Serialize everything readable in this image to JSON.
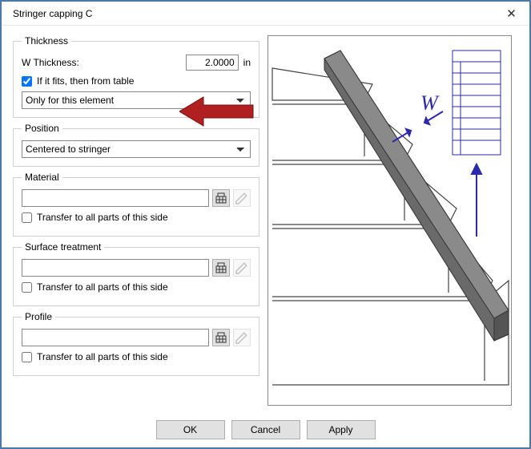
{
  "title": "Stringer capping C",
  "thickness": {
    "legend": "Thickness",
    "label": "W Thickness:",
    "value": "2.0000",
    "unit": "in",
    "checkbox_label": "If it fits, then from table",
    "checkbox_checked": true,
    "scope": "Only for this element"
  },
  "position": {
    "legend": "Position",
    "value": "Centered to stringer"
  },
  "material": {
    "legend": "Material",
    "value": "",
    "transfer_label": "Transfer to all parts of this side",
    "transfer_checked": false
  },
  "surface": {
    "legend": "Surface treatment",
    "value": "",
    "transfer_label": "Transfer to all parts of this side",
    "transfer_checked": false
  },
  "profile": {
    "legend": "Profile",
    "value": "",
    "transfer_label": "Transfer to all parts of this side",
    "transfer_checked": false
  },
  "buttons": {
    "ok": "OK",
    "cancel": "Cancel",
    "apply": "Apply"
  },
  "preview": {
    "w_label": "W"
  }
}
